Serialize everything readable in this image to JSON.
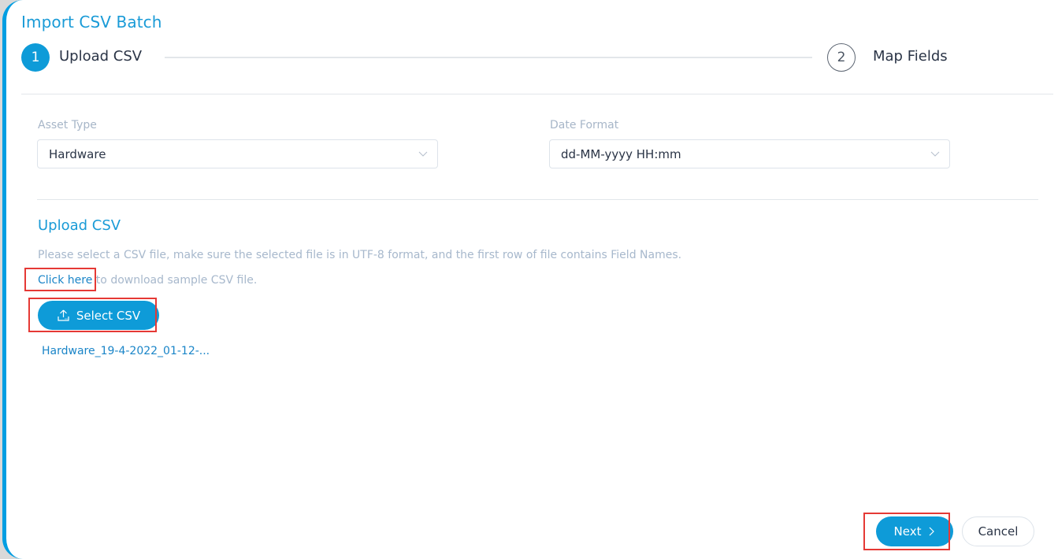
{
  "dialog": {
    "title": "Import CSV Batch"
  },
  "stepper": {
    "steps": [
      {
        "number": "1",
        "label": "Upload CSV",
        "active": true
      },
      {
        "number": "2",
        "label": "Map Fields",
        "active": false
      }
    ]
  },
  "form": {
    "asset_type": {
      "label": "Asset Type",
      "value": "Hardware"
    },
    "date_format": {
      "label": "Date Format",
      "value": "dd-MM-yyyy HH:mm"
    }
  },
  "upload": {
    "section_title": "Upload CSV",
    "help_text": "Please select a CSV file, make sure the selected file is in UTF-8 format, and the first row of file contains Field Names.",
    "download_link": "Click here",
    "download_suffix": " to download sample CSV file.",
    "select_button": "Select CSV",
    "select_icon": "upload-icon",
    "selected_file": "Hardware_19-4-2022_01-12-..."
  },
  "footer": {
    "next_label": "Next",
    "next_icon": "chevron-right-icon",
    "cancel_label": "Cancel"
  },
  "colors": {
    "accent": "#0e9bd8",
    "title": "#1a9bd7",
    "highlight": "#e53935"
  }
}
